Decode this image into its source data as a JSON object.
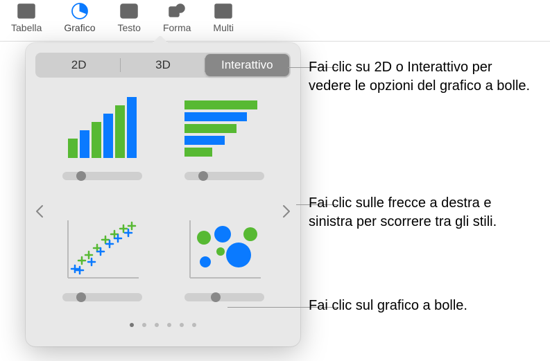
{
  "toolbar": {
    "items": [
      {
        "label": "Tabella"
      },
      {
        "label": "Grafico"
      },
      {
        "label": "Testo"
      },
      {
        "label": "Forma"
      },
      {
        "label": "Multi"
      }
    ],
    "active_index": 1
  },
  "popover": {
    "segments": {
      "one": "2D",
      "two": "3D",
      "three": "Interattivo"
    },
    "selected_segment": "three",
    "page_count": 6,
    "active_page": 0
  },
  "callouts": {
    "c1": "Fai clic su 2D o Interattivo per vedere le opzioni del grafico a bolle.",
    "c2": "Fai clic sulle frecce a destra e sinistra per scorrere tra gli stili.",
    "c3": "Fai clic sul grafico a bolle."
  }
}
